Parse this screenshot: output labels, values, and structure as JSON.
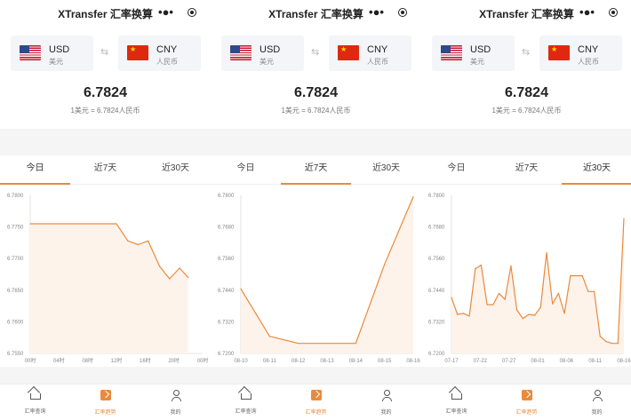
{
  "app": {
    "title": "XTransfer 汇率换算"
  },
  "converter": {
    "from_code": "USD",
    "from_name": "美元",
    "to_code": "CNY",
    "to_name": "人民币",
    "swap_icon": "swap-icon",
    "rate": "6.7824",
    "rate_sub": "1美元 = 6.7824人民币"
  },
  "tabs": [
    "今日",
    "近7天",
    "近30天"
  ],
  "nav": [
    {
      "label": "汇率查询",
      "icon": "home-icon"
    },
    {
      "label": "汇率趋势",
      "icon": "trend-icon"
    },
    {
      "label": "我的",
      "icon": "user-icon"
    }
  ],
  "colors": {
    "accent": "#e98a3c",
    "fill": "#fdf3ea"
  },
  "screens": [
    {
      "active_tab": 0
    },
    {
      "active_tab": 1
    },
    {
      "active_tab": 2
    }
  ],
  "chart_data": [
    {
      "type": "line",
      "title": "",
      "x": [
        "00时",
        "04时",
        "08时",
        "12时",
        "16时",
        "20时",
        "00时"
      ],
      "ylim": [
        6.755,
        6.78
      ],
      "yticks": [
        "6.7800",
        "6.7750",
        "6.7700",
        "6.7650",
        "6.7600",
        "6.7550"
      ],
      "points": [
        [
          0,
          6.7755
        ],
        [
          2.6,
          6.7755
        ],
        [
          3.0,
          6.7755
        ],
        [
          3.4,
          6.7728
        ],
        [
          3.75,
          6.7722
        ],
        [
          4.1,
          6.7728
        ],
        [
          4.5,
          6.7688
        ],
        [
          4.85,
          6.7668
        ],
        [
          5.2,
          6.7685
        ],
        [
          5.5,
          6.767
        ]
      ]
    },
    {
      "type": "line",
      "title": "",
      "x": [
        "08-10",
        "08-11",
        "08-12",
        "08-13",
        "08-14",
        "08-15",
        "08-16"
      ],
      "ylim": [
        6.72,
        6.78
      ],
      "yticks": [
        "6.7800",
        "6.7680",
        "6.7560",
        "6.7440",
        "6.7320",
        "6.7200"
      ],
      "points": [
        [
          0,
          6.7445
        ],
        [
          1,
          6.7265
        ],
        [
          2,
          6.7238
        ],
        [
          3,
          6.7238
        ],
        [
          4,
          6.7238
        ],
        [
          5,
          6.7538
        ],
        [
          6,
          6.7795
        ]
      ]
    },
    {
      "type": "line",
      "title": "",
      "x": [
        "07-17",
        "07-22",
        "07-27",
        "08-01",
        "08-06",
        "08-11",
        "08-16"
      ],
      "ylim": [
        6.72,
        6.78
      ],
      "yticks": [
        "6.7800",
        "6.7680",
        "6.7560",
        "6.7440",
        "6.7320",
        "6.7200"
      ],
      "points": [
        [
          0,
          6.7412
        ],
        [
          1,
          6.7348
        ],
        [
          2,
          6.7352
        ],
        [
          3,
          6.7342
        ],
        [
          4,
          6.7522
        ],
        [
          5,
          6.7535
        ],
        [
          6,
          6.7385
        ],
        [
          7,
          6.7385
        ],
        [
          8,
          6.7428
        ],
        [
          9,
          6.7405
        ],
        [
          10,
          6.7532
        ],
        [
          11,
          6.7365
        ],
        [
          12,
          6.7332
        ],
        [
          13,
          6.7348
        ],
        [
          14,
          6.7345
        ],
        [
          15,
          6.7375
        ],
        [
          16,
          6.7582
        ],
        [
          17,
          6.7388
        ],
        [
          18,
          6.7428
        ],
        [
          19,
          6.7352
        ],
        [
          20,
          6.7495
        ],
        [
          21,
          6.7495
        ],
        [
          22,
          6.7495
        ],
        [
          23,
          6.7435
        ],
        [
          24,
          6.7435
        ],
        [
          25,
          6.7265
        ],
        [
          26,
          6.7245
        ],
        [
          27,
          6.7238
        ],
        [
          28,
          6.7238
        ],
        [
          29,
          6.7712
        ]
      ]
    }
  ]
}
